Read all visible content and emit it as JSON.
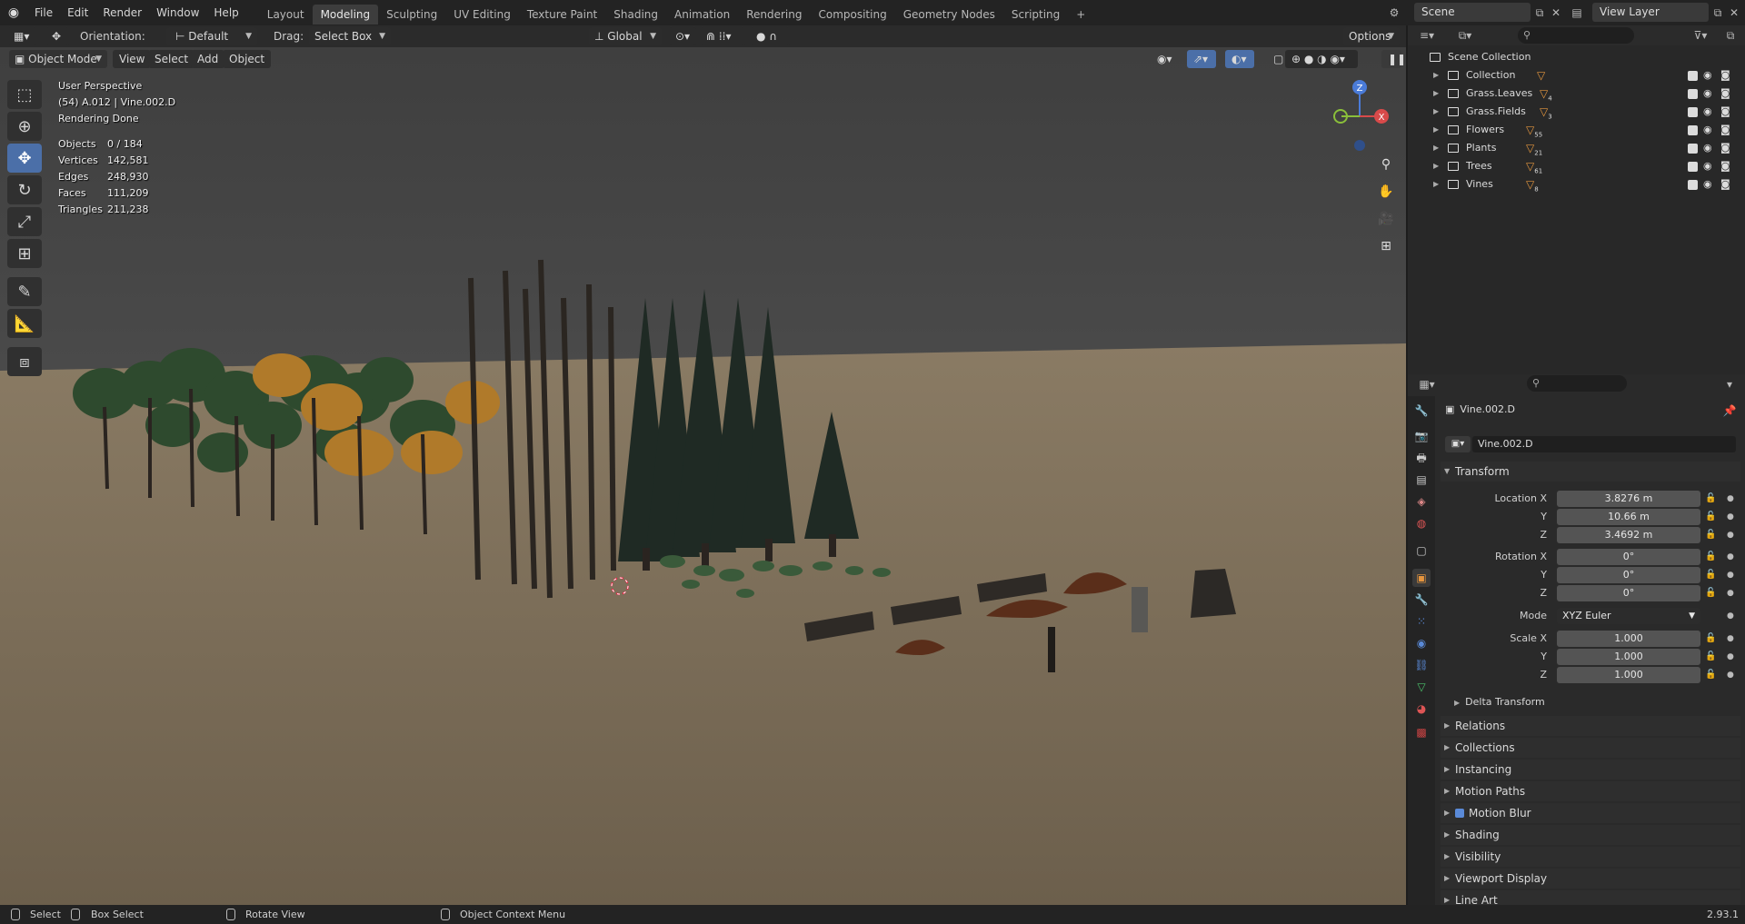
{
  "app": {
    "menus": [
      "File",
      "Edit",
      "Render",
      "Window",
      "Help"
    ],
    "workspace_tabs": [
      "Layout",
      "Modeling",
      "Sculpting",
      "UV Editing",
      "Texture Paint",
      "Shading",
      "Animation",
      "Rendering",
      "Compositing",
      "Geometry Nodes",
      "Scripting"
    ],
    "active_tab": "Modeling",
    "add_tab": "+",
    "scene": "Scene",
    "view_layer": "View Layer"
  },
  "viewport_header": {
    "orientation_label": "Orientation:",
    "orientation_value": "Default",
    "drag_label": "Drag:",
    "drag_value": "Select Box",
    "transform_space": "Global",
    "options": "Options",
    "mode": "Object Mode",
    "menus": [
      "View",
      "Select",
      "Add",
      "Object"
    ]
  },
  "viewport_info": {
    "perspective": "User Perspective",
    "object": "(54) A.012 | Vine.002.D",
    "status": "Rendering Done"
  },
  "stats": [
    {
      "label": "Objects",
      "value": "0 / 184"
    },
    {
      "label": "Vertices",
      "value": "142,581"
    },
    {
      "label": "Edges",
      "value": "248,930"
    },
    {
      "label": "Faces",
      "value": "111,209"
    },
    {
      "label": "Triangles",
      "value": "211,238"
    }
  ],
  "gizmo": {
    "x": "X",
    "y": "Y",
    "z": "Z"
  },
  "outliner": {
    "root": "Scene Collection",
    "collections": [
      {
        "name": "Collection",
        "count": ""
      },
      {
        "name": "Grass.Leaves",
        "count": "4"
      },
      {
        "name": "Grass.Fields",
        "count": "3"
      },
      {
        "name": "Flowers",
        "count": "55"
      },
      {
        "name": "Plants",
        "count": "21"
      },
      {
        "name": "Trees",
        "count": "61"
      },
      {
        "name": "Vines",
        "count": "8"
      }
    ]
  },
  "properties": {
    "object_name": "Vine.002.D",
    "datablock_name": "Vine.002.D",
    "transform_title": "Transform",
    "location_label": "Location X",
    "location": [
      "3.8276 m",
      "10.66 m",
      "3.4692 m"
    ],
    "rotation_label": "Rotation X",
    "rotation": [
      "0°",
      "0°",
      "0°"
    ],
    "mode_label": "Mode",
    "mode_value": "XYZ Euler",
    "scale_label": "Scale X",
    "scale": [
      "1.000",
      "1.000",
      "1.000"
    ],
    "axis_y": "Y",
    "axis_z": "Z",
    "delta_transform": "Delta Transform",
    "panels": [
      "Relations",
      "Collections",
      "Instancing",
      "Motion Paths",
      "Motion Blur",
      "Shading",
      "Visibility",
      "Viewport Display",
      "Line Art"
    ]
  },
  "statusbar": {
    "select": "Select",
    "box_select": "Box Select",
    "rotate_view": "Rotate View",
    "context_menu": "Object Context Menu",
    "version": "2.93.1"
  }
}
